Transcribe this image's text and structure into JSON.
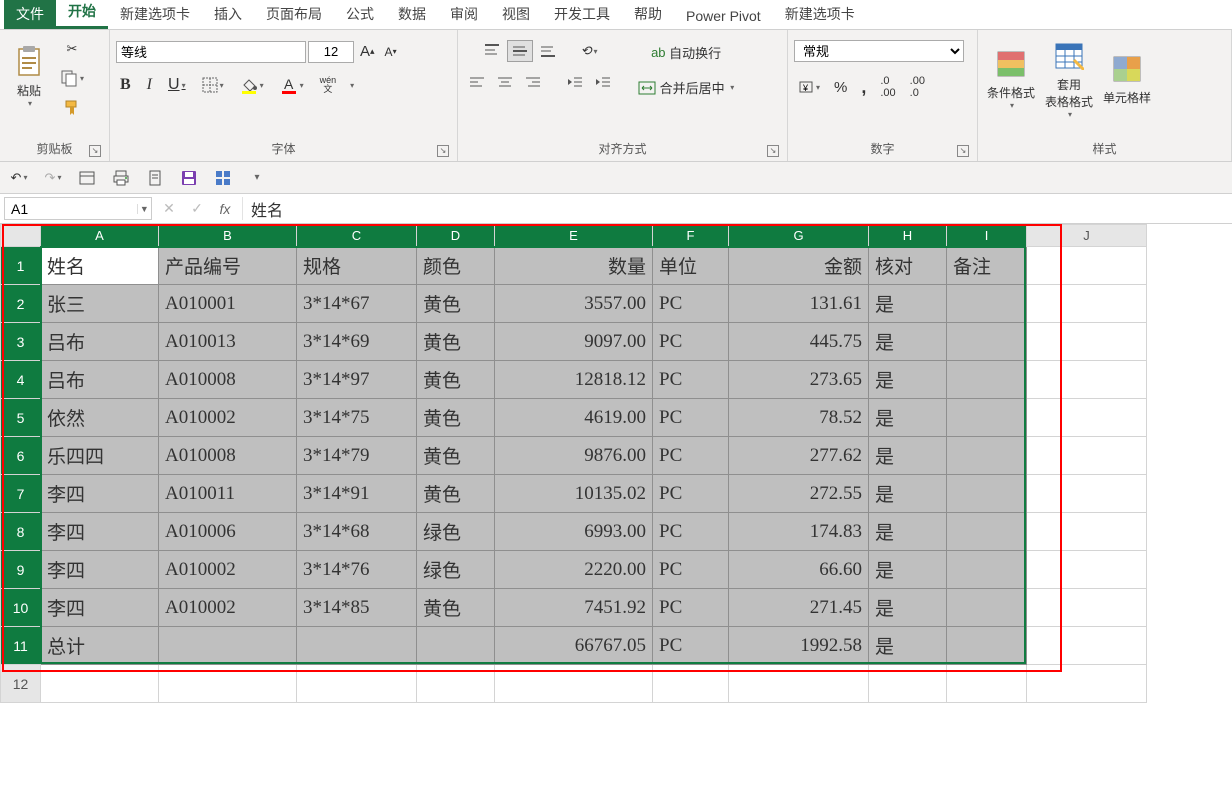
{
  "tabs": [
    "文件",
    "开始",
    "新建选项卡",
    "插入",
    "页面布局",
    "公式",
    "数据",
    "审阅",
    "视图",
    "开发工具",
    "帮助",
    "Power Pivot",
    "新建选项卡"
  ],
  "activeTab": 1,
  "ribbon": {
    "clipboard": {
      "paste": "粘贴",
      "label": "剪贴板"
    },
    "font": {
      "name": "等线",
      "size": "12",
      "label": "字体",
      "bold": "B",
      "italic": "I",
      "underline": "U",
      "wen": "wén\n文"
    },
    "align": {
      "label": "对齐方式",
      "wrap": "自动换行",
      "merge": "合并后居中"
    },
    "number": {
      "label": "数字",
      "format": "常规"
    },
    "styles": {
      "label": "样式",
      "cond": "条件格式",
      "tablefmt": "套用\n表格格式",
      "cellfmt": "单元格样"
    }
  },
  "formulaBar": {
    "cell": "A1",
    "value": "姓名"
  },
  "columns": [
    "A",
    "B",
    "C",
    "D",
    "E",
    "F",
    "G",
    "H",
    "I",
    "J"
  ],
  "selectedCols": [
    "A",
    "B",
    "C",
    "D",
    "E",
    "F",
    "G",
    "H",
    "I"
  ],
  "headers": [
    "姓名",
    "产品编号",
    "规格",
    "颜色",
    "数量",
    "单位",
    "金额",
    "核对",
    "备注"
  ],
  "rows": [
    {
      "r": 2,
      "c": [
        "张三",
        "A010001",
        "3*14*67",
        "黄色",
        "3557.00",
        "PC",
        "131.61",
        "是",
        ""
      ]
    },
    {
      "r": 3,
      "c": [
        "吕布",
        "A010013",
        "3*14*69",
        "黄色",
        "9097.00",
        "PC",
        "445.75",
        "是",
        ""
      ]
    },
    {
      "r": 4,
      "c": [
        "吕布",
        "A010008",
        "3*14*97",
        "黄色",
        "12818.12",
        "PC",
        "273.65",
        "是",
        ""
      ]
    },
    {
      "r": 5,
      "c": [
        "依然",
        "A010002",
        "3*14*75",
        "黄色",
        "4619.00",
        "PC",
        "78.52",
        "是",
        ""
      ]
    },
    {
      "r": 6,
      "c": [
        "乐四四",
        "A010008",
        "3*14*79",
        "黄色",
        "9876.00",
        "PC",
        "277.62",
        "是",
        ""
      ]
    },
    {
      "r": 7,
      "c": [
        "李四",
        "A010011",
        "3*14*91",
        "黄色",
        "10135.02",
        "PC",
        "272.55",
        "是",
        ""
      ]
    },
    {
      "r": 8,
      "c": [
        "李四",
        "A010006",
        "3*14*68",
        "绿色",
        "6993.00",
        "PC",
        "174.83",
        "是",
        ""
      ]
    },
    {
      "r": 9,
      "c": [
        "李四",
        "A010002",
        "3*14*76",
        "绿色",
        "2220.00",
        "PC",
        "66.60",
        "是",
        ""
      ]
    },
    {
      "r": 10,
      "c": [
        "李四",
        "A010002",
        "3*14*85",
        "黄色",
        "7451.92",
        "PC",
        "271.45",
        "是",
        ""
      ]
    },
    {
      "r": 11,
      "c": [
        "总计",
        "",
        "",
        "",
        "66767.05",
        "PC",
        "1992.58",
        "是",
        ""
      ]
    }
  ],
  "emptyRow": 12,
  "chart_data": {
    "type": "table",
    "title": "",
    "columns": [
      "姓名",
      "产品编号",
      "规格",
      "颜色",
      "数量",
      "单位",
      "金额",
      "核对",
      "备注"
    ],
    "data": [
      [
        "张三",
        "A010001",
        "3*14*67",
        "黄色",
        3557.0,
        "PC",
        131.61,
        "是",
        ""
      ],
      [
        "吕布",
        "A010013",
        "3*14*69",
        "黄色",
        9097.0,
        "PC",
        445.75,
        "是",
        ""
      ],
      [
        "吕布",
        "A010008",
        "3*14*97",
        "黄色",
        12818.12,
        "PC",
        273.65,
        "是",
        ""
      ],
      [
        "依然",
        "A010002",
        "3*14*75",
        "黄色",
        4619.0,
        "PC",
        78.52,
        "是",
        ""
      ],
      [
        "乐四四",
        "A010008",
        "3*14*79",
        "黄色",
        9876.0,
        "PC",
        277.62,
        "是",
        ""
      ],
      [
        "李四",
        "A010011",
        "3*14*91",
        "黄色",
        10135.02,
        "PC",
        272.55,
        "是",
        ""
      ],
      [
        "李四",
        "A010006",
        "3*14*68",
        "绿色",
        6993.0,
        "PC",
        174.83,
        "是",
        ""
      ],
      [
        "李四",
        "A010002",
        "3*14*76",
        "绿色",
        2220.0,
        "PC",
        66.6,
        "是",
        ""
      ],
      [
        "李四",
        "A010002",
        "3*14*85",
        "黄色",
        7451.92,
        "PC",
        271.45,
        "是",
        ""
      ],
      [
        "总计",
        "",
        "",
        "",
        66767.05,
        "PC",
        1992.58,
        "是",
        ""
      ]
    ]
  }
}
